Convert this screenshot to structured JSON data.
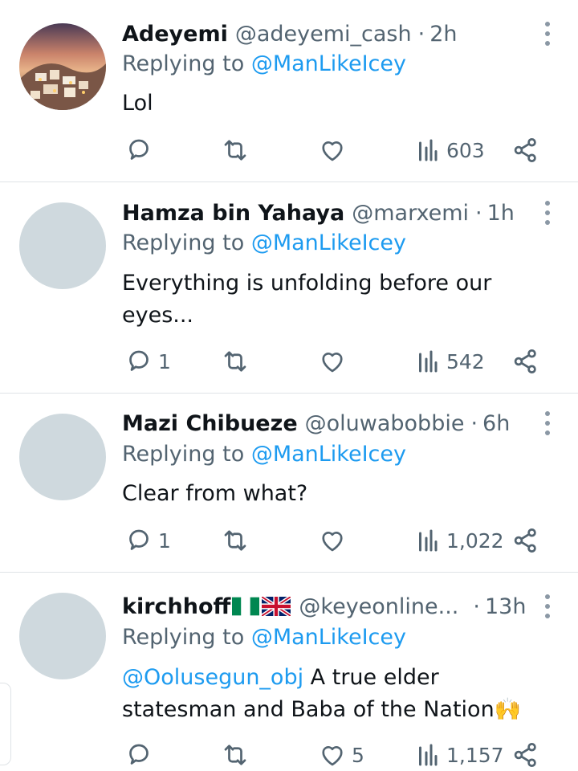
{
  "colors": {
    "accent": "#1d9bf0",
    "text": "#0f1419",
    "muted": "#536471",
    "avatar_placeholder": "#cfd9de"
  },
  "replying_prefix": "Replying to",
  "tweets": [
    {
      "name": "Adeyemi",
      "handle": "@adeyemi_cash",
      "time": "2h",
      "replying_to": "@ManLikeIcey",
      "body": "Lol",
      "reply_count": "",
      "like_count": "",
      "views": "603",
      "avatar": "sunset-village-photo"
    },
    {
      "name": "Hamza bin Yahaya",
      "handle": "@marxemi",
      "time": "1h",
      "replying_to": "@ManLikeIcey",
      "body": "Everything is unfolding before our eyes...",
      "reply_count": "1",
      "like_count": "",
      "views": "542",
      "avatar": "default-avatar"
    },
    {
      "name": "Mazi Chibueze",
      "handle": "@oluwabobbie",
      "time": "6h",
      "replying_to": "@ManLikeIcey",
      "body": "Clear from what?",
      "reply_count": "1",
      "like_count": "",
      "views": "1,022",
      "avatar": "default-avatar"
    },
    {
      "name": "kirchhoff",
      "name_flags": [
        "nigeria-flag-icon",
        "uk-flag-icon"
      ],
      "handle": "@keyeonline...",
      "time": "13h",
      "replying_to": "@ManLikeIcey",
      "body_mention": "@Oolusegun_obj",
      "body": " A true elder statesman and Baba of the Nation",
      "body_emoji": "🙌",
      "reply_count": "",
      "like_count": "5",
      "views": "1,157",
      "avatar": "default-avatar"
    }
  ]
}
